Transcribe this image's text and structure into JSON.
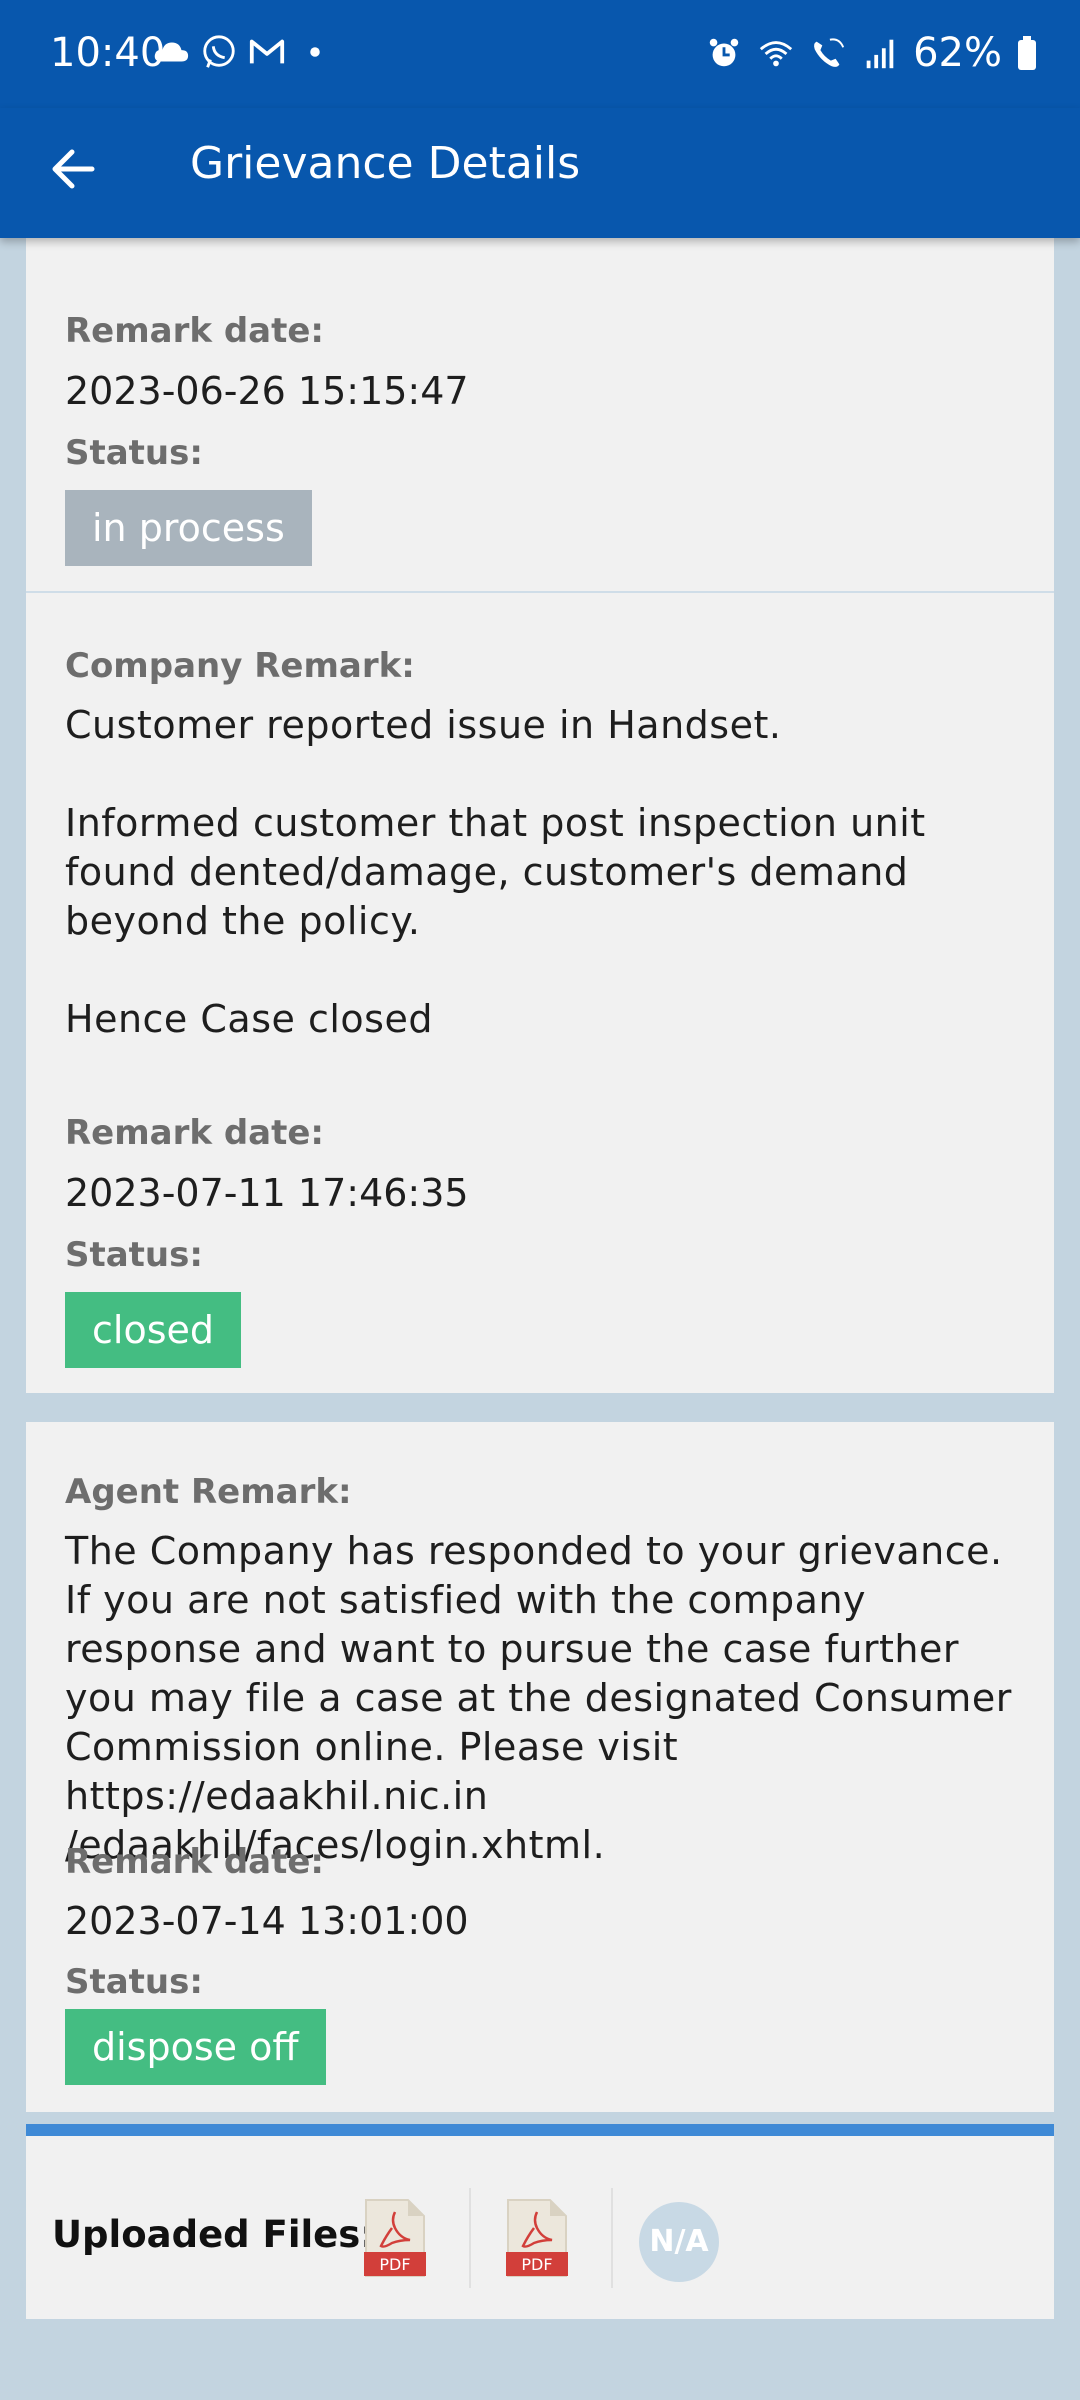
{
  "status_bar": {
    "time": "10:40",
    "battery": "62%",
    "left_icons": [
      "cloud-icon",
      "whatsapp-icon",
      "gmail-icon",
      "dot-icon"
    ],
    "right_icons": [
      "alarm-icon",
      "wifi-icon",
      "wifi-call-icon",
      "signal-icon",
      "battery-icon"
    ]
  },
  "app_bar": {
    "title": "Grievance Details",
    "back_icon": "arrow-back-icon"
  },
  "remarks": [
    {
      "remark_date_label": "Remark date:",
      "remark_date": "2023-06-26 15:15:47",
      "status_label": "Status:",
      "status": "in process",
      "status_color": "#a9b4bd"
    },
    {
      "title": "Company Remark:",
      "lines": [
        "Customer reported issue in Handset.",
        "",
        "Informed customer that post inspection unit found dented/damage, customer's demand beyond the policy.",
        "",
        "Hence Case closed"
      ],
      "remark_date_label": "Remark date:",
      "remark_date": "2023-07-11 17:46:35",
      "status_label": "Status:",
      "status": "closed",
      "status_color": "#44bd82"
    },
    {
      "title": "Agent Remark:",
      "text": "The Company has responded to your grievance. If you are not satisfied with the company response and want to pursue the case further you may file a case at the designated Consumer Commission online. Please visit https://edaakhil.nic.in /edaakhil/faces/login.xhtml.",
      "remark_date_label": "Remark date:",
      "remark_date": "2023-07-14 13:01:00",
      "status_label": "Status:",
      "status": "dispose off",
      "status_color": "#44bd82"
    }
  ],
  "uploaded_files": {
    "label": "Uploaded Files:",
    "files": [
      {
        "icon": "pdf-icon",
        "label": "PDF"
      },
      {
        "icon": "pdf-icon",
        "label": "PDF"
      },
      {
        "icon": "na-icon",
        "label": "N/A"
      }
    ]
  },
  "colors": {
    "primary": "#0857ad",
    "background": "#c3d4e0",
    "card": "#f1f1f1",
    "accent_bar": "#3f8ad6",
    "pdf_red": "#d23f3a"
  }
}
